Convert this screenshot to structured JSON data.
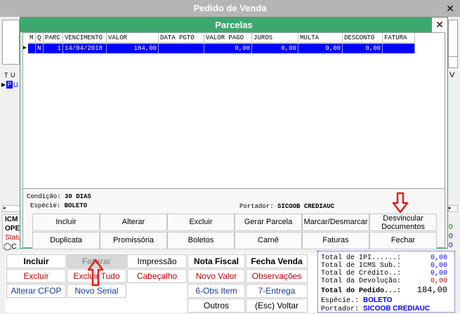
{
  "window": {
    "title": "Pedido de Venda"
  },
  "dialog": {
    "title": "Parcelas",
    "grid": {
      "headers": [
        "M",
        "Q",
        "PARC",
        "VENCIMENTO",
        "VALOR",
        "DATA PGTO",
        "VALOR PAGO",
        "JUROS",
        "MULTA",
        "DESCONTO",
        "FATURA"
      ],
      "rows": [
        [
          "",
          "N",
          "1",
          "14/04/2018",
          "184,00",
          "",
          "0,00",
          "0,00",
          "0,00",
          "0,00",
          ""
        ]
      ]
    },
    "condicao_label": "Condição:",
    "condicao_value": "30 DIAS",
    "especie_label": "Espécie:",
    "especie_value": "BOLETO",
    "portador_label": "Portador:",
    "portador_value": "SICOOB CREDIAUC",
    "buttons_row1": [
      "Incluir",
      "Alterar",
      "Excluir",
      "Gerar Parcela",
      "Marcar/Desmarcar",
      "Desvincular Documentos"
    ],
    "buttons_row2": [
      "Duplicata",
      "Promissória",
      "Boletos",
      "Carnê",
      "Faturas",
      "Fechar"
    ]
  },
  "left_fragments": {
    "t_col": "T",
    "u_col": "U",
    "p_cell": "P",
    "u_cell": "U",
    "icm": "ICM",
    "ope": "OPE",
    "status": "Statu",
    "radio_c": "C"
  },
  "main_buttons": {
    "incluir": "Incluir",
    "faturar": "Faturar",
    "impressao": "Impressão",
    "nota_fiscal": "Nota Fiscal",
    "fecha_venda": "Fecha Venda",
    "excluir": "Excluir",
    "excluir_tudo": "Excluir Tudo",
    "cabecalho": "Cabeçalho",
    "novo_valor": "Novo Valor",
    "observacoes": "Observações",
    "alterar_cfop": "Alterar CFOP",
    "novo_serial": "Novo Serial",
    "obs_item": "6-Obs Item",
    "entrega": "7-Entrega",
    "outros": "Outros",
    "voltar": "(Esc) Voltar"
  },
  "totals": {
    "ipi_label": "Total de IPI......:",
    "ipi_value": "0,00",
    "icms_label": "Total de ICMS Sub.:",
    "icms_value": "0,00",
    "credito_label": "Total de Crédito..:",
    "credito_value": "0,00",
    "devolucao_label": "Total da Devolução:",
    "devolucao_value": "0,00",
    "pedido_label": "Total do Pedido...:",
    "pedido_value": "184,00",
    "especie_label": "Espécie.:",
    "especie_value": "BOLETO",
    "portador_label": "Portador:",
    "portador_value": "SICOOB CREDIAUC",
    "partial_values": [
      "0",
      "0",
      "0"
    ]
  },
  "colors": {
    "accent_green": "#3ea76e",
    "selection_blue": "#0000ff",
    "red_text": "#c00000",
    "annotation_red": "#e02020"
  }
}
